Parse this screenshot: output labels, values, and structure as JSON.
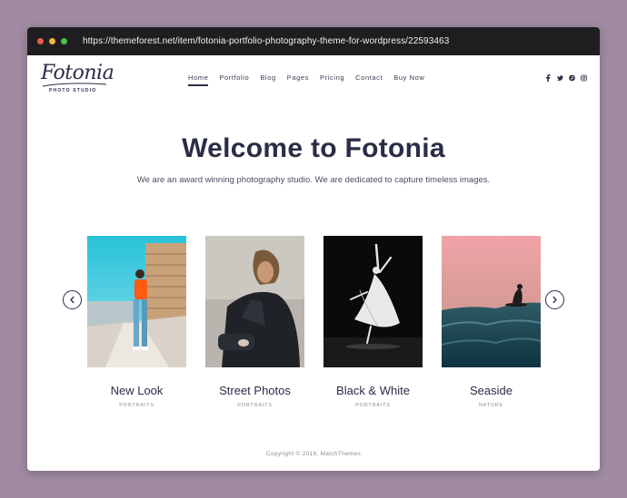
{
  "browser": {
    "url": "https://themeforest.net/item/fotonia-portfolio-photography-theme-for-wordpress/22593463"
  },
  "logo": {
    "script": "Fotonia",
    "tagline": "PHOTO STUDIO"
  },
  "nav": {
    "items": [
      {
        "label": "Home",
        "active": true
      },
      {
        "label": "Portfolio"
      },
      {
        "label": "Blog"
      },
      {
        "label": "Pages"
      },
      {
        "label": "Pricing"
      },
      {
        "label": "Contact"
      },
      {
        "label": "Buy Now"
      }
    ]
  },
  "social": [
    "facebook-icon",
    "twitter-icon",
    "pinterest-icon",
    "instagram-icon"
  ],
  "hero": {
    "title": "Welcome to Fotonia",
    "subtitle": "We are an award winning photography studio. We are dedicated to capture timeless images."
  },
  "gallery": {
    "items": [
      {
        "title": "New Look",
        "category": "PORTRAITS"
      },
      {
        "title": "Street Photos",
        "category": "PORTRAITS"
      },
      {
        "title": "Black & White",
        "category": "PORTRAITS"
      },
      {
        "title": "Seaside",
        "category": "NATURE"
      }
    ]
  },
  "footer": {
    "copyright": "Copyright © 2019, MatchThemes"
  },
  "colors": {
    "background": "#a08ba2",
    "titlebar": "#1e1e20",
    "text_dark": "#2a2d45",
    "text_muted": "#8b8d98"
  }
}
